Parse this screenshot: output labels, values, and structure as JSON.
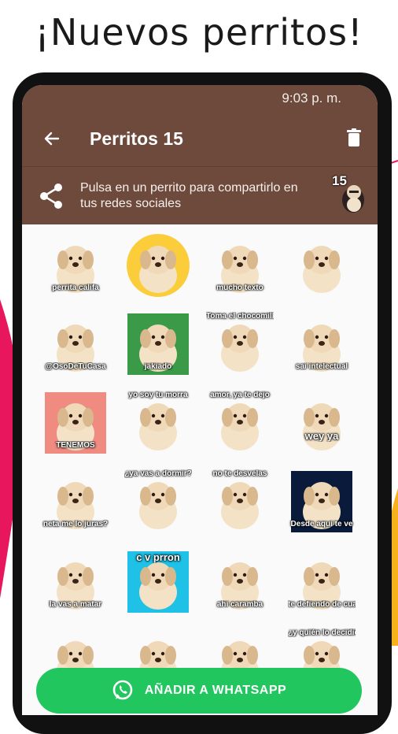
{
  "headline": "¡Nuevos perritos!",
  "statusbar": {
    "time": "9:03 p. m."
  },
  "appbar": {
    "title": "Perritos 15",
    "back_icon": "arrow-left-icon",
    "delete_icon": "trash-icon"
  },
  "info": {
    "text": "Pulsa en un perrito para compartirlo en tus redes sociales",
    "share_icon": "share-icon",
    "pack_badge": "15"
  },
  "stickers": [
    {
      "caption": "perrita califa"
    },
    {
      "caption": ""
    },
    {
      "caption": "mucho texto"
    },
    {
      "caption": ""
    },
    {
      "caption": "@OsoDeTuCasa"
    },
    {
      "caption": "jakiado"
    },
    {
      "caption": "Toma el chocomilk"
    },
    {
      "caption": "sai intelectual"
    },
    {
      "caption": "TENEMOS"
    },
    {
      "caption": "yo soy tu morra"
    },
    {
      "caption": "amor, ya te dejo"
    },
    {
      "caption": "wey ya"
    },
    {
      "caption": "neta me lo juras?"
    },
    {
      "caption": "¿ya vas a dormir?"
    },
    {
      "caption": "no te desvelas"
    },
    {
      "caption": "Desde aquí te ve"
    },
    {
      "caption": "la vas a matar"
    },
    {
      "caption": "c v prron"
    },
    {
      "caption": "ahi caramba"
    },
    {
      "caption": "te defiendo de cualquier cosa"
    },
    {
      "caption": ""
    },
    {
      "caption": ""
    },
    {
      "caption": ""
    },
    {
      "caption": "¿y quién lo decidió?"
    }
  ],
  "cta": {
    "label": "AÑADIR A WHATSAPP",
    "icon": "whatsapp-icon"
  },
  "colors": {
    "appbar": "#6d4a3b",
    "cta": "#21c65f",
    "accent_pink": "#e8175d"
  }
}
